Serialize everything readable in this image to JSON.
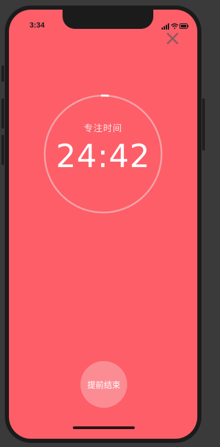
{
  "status_bar": {
    "time": "3:34",
    "icons": [
      "signal-icon",
      "wifi-icon",
      "battery-icon"
    ]
  },
  "header": {
    "close_icon": "close-icon"
  },
  "timer": {
    "label": "专注时间",
    "value": "24:42",
    "progress_fraction": 0.012
  },
  "actions": {
    "end_early_label": "提前结束"
  },
  "colors": {
    "background": "#fd5e68",
    "ring": "#f4a2a7",
    "progress": "#ffffff",
    "button": "#fc8c93"
  }
}
